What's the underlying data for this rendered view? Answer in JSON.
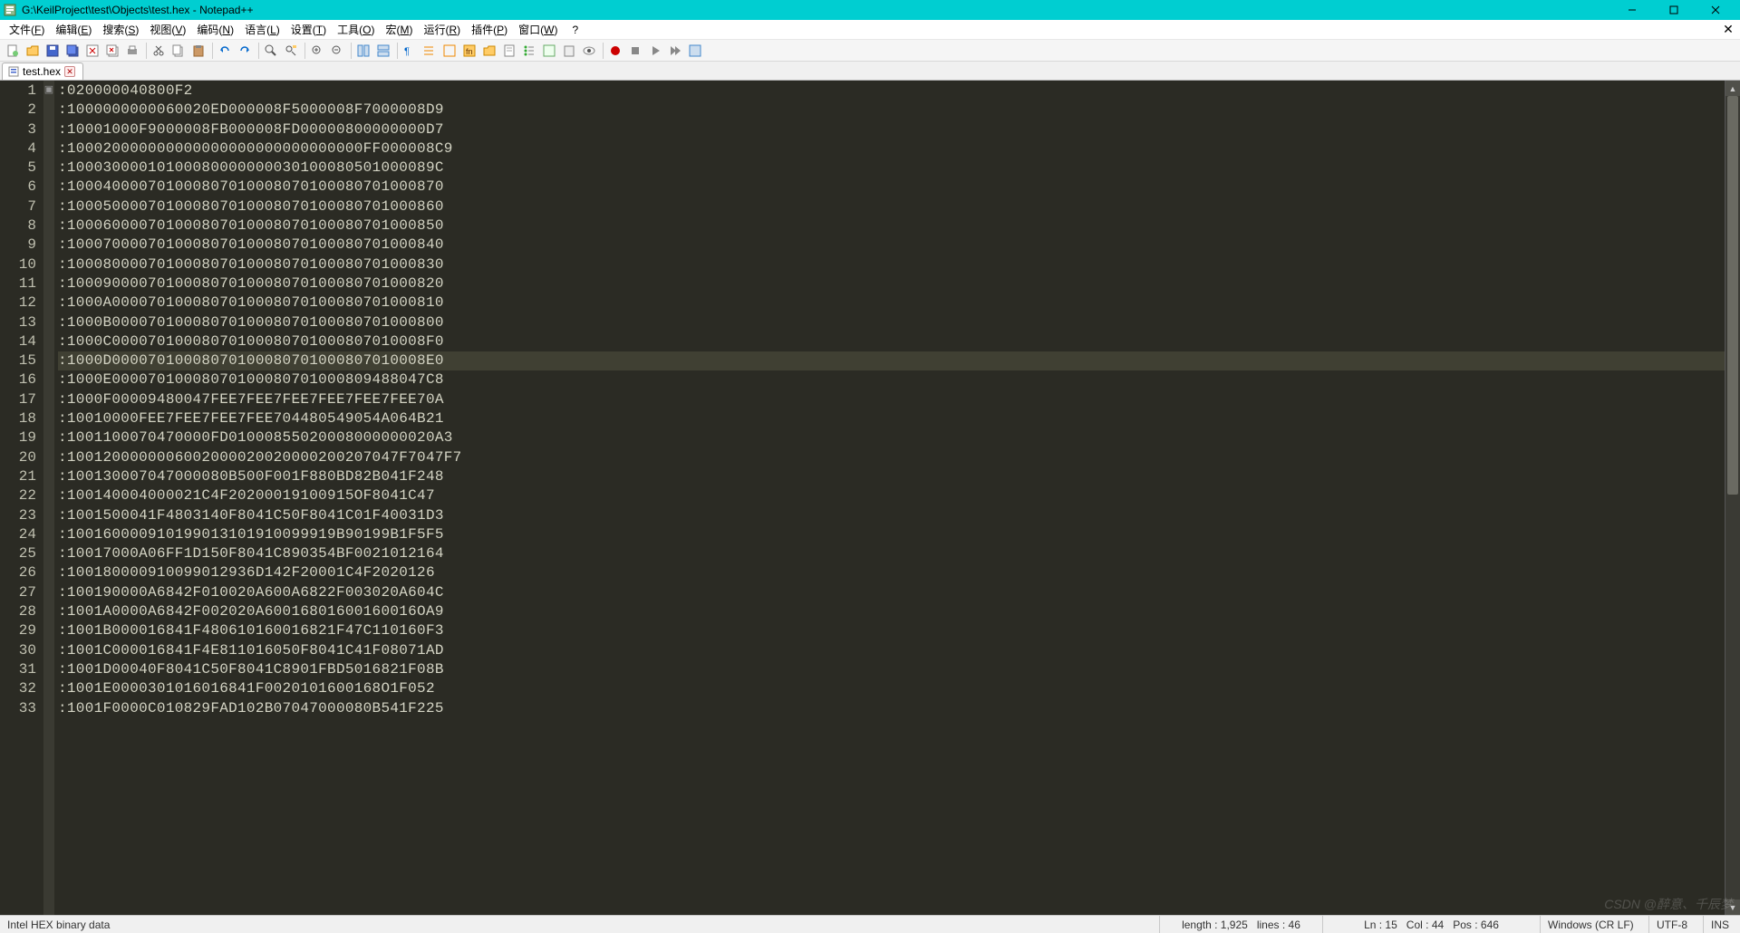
{
  "title": "G:\\KeilProject\\test\\Objects\\test.hex - Notepad++",
  "menus": [
    "文件(F)",
    "编辑(E)",
    "搜索(S)",
    "视图(V)",
    "编码(N)",
    "语言(L)",
    "设置(T)",
    "工具(O)",
    "宏(M)",
    "运行(R)",
    "插件(P)",
    "窗口(W)",
    "?"
  ],
  "tab": {
    "label": "test.hex"
  },
  "current_line_index": 14,
  "lines": [
    ":020000040800F2",
    ":1000000000060020ED000008F5000008F7000008D9",
    ":10001000F9000008FB000008FD00000800000000D7",
    ":100020000000000000000000000000000FF000008C9",
    ":10003000010100080000000030100080501000089C",
    ":100040000701000807010008070100080701000870",
    ":100050000701000807010008070100080701000860",
    ":100060000701000807010008070100080701000850",
    ":100070000701000807010008070100080701000840",
    ":100080000701000807010008070100080701000830",
    ":100090000701000807010008070100080701000820",
    ":1000A0000701000807010008070100080701000810",
    ":1000B0000701000807010008070100080701000800",
    ":1000C00007010008070100080701000807010008F0",
    ":1000D00007010008070100080701000807010008E0",
    ":1000E00007010008070100080701000809488047C8",
    ":1000F00009480047FEE7FEE7FEE7FEE7FEE7FEE70A",
    ":10010000FEE7FEE7FEE7FEE704480549054A064B21",
    ":1001100070470000FD01000855020008000000020A3",
    ":1001200000006002000020020000200207047F7047F7",
    ":100130007047000080B500F001F880BD82B041F248",
    ":100140004000021C4F20200019100915OF8041C47",
    ":1001500041F4803140F8041C50F8041C01F40031D3",
    ":100160000910199013101910099919B90199B1F5F5",
    ":10017000A06FF1D150F8041C890354BF0021012164",
    ":100180000910099012936D142F20001C4F2020126",
    ":100190000A6842F010020A600A6822F003020A604C",
    ":1001A0000A6842F002020A60016801600160016OA9",
    ":1001B000016841F480610160016821F47C110160F3",
    ":1001C000016841F4E811016050F8041C41F08071AD",
    ":1001D00040F8041C50F8041C8901FBD5016821F08B",
    ":1001E0000301016016841F0020101600168O1F052",
    ":1001F0000C010829FAD102B07047000080B541F225"
  ],
  "status": {
    "lang": "Intel HEX binary data",
    "length_label": "length :",
    "length_value": "1,925",
    "lines_label": "lines :",
    "lines_value": "46",
    "ln_label": "Ln :",
    "ln_value": "15",
    "col_label": "Col :",
    "col_value": "44",
    "pos_label": "Pos :",
    "pos_value": "646",
    "eol": "Windows (CR LF)",
    "encoding": "UTF-8",
    "ovr": "INS"
  },
  "watermark": "CSDN @醉意、千辰梦"
}
